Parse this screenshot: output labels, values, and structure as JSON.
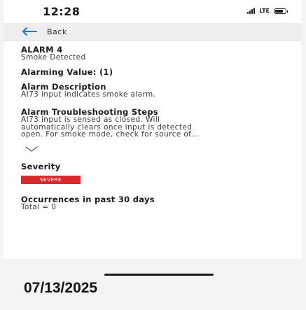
{
  "status_bar": {
    "time": "12:28",
    "network": "LTE"
  },
  "nav": {
    "back_label": "Back",
    "accent": "#1f6fd8"
  },
  "alarm": {
    "title": "ALARM 4",
    "subtitle": "Smoke Detected",
    "alarming_value": "Alarming Value: (1)",
    "description_heading": "Alarm Description",
    "description_text": "AI73 input indicates smoke alarm.",
    "troubleshooting_heading": "Alarm Troubleshooting Steps",
    "troubleshooting_lines": [
      "AI73 input is sensed as closed. Will",
      "automatically clears once input is detected",
      "open. For smoke mode, check for source of..."
    ],
    "severity_heading": "Severity",
    "severity_value": "SEVERE",
    "severity_color": "#d72a2a",
    "occurrences_heading": "Occurrences in past 30 days",
    "occurrences_text": "Total = 0"
  },
  "footer": {
    "date": "07/13/2025"
  }
}
